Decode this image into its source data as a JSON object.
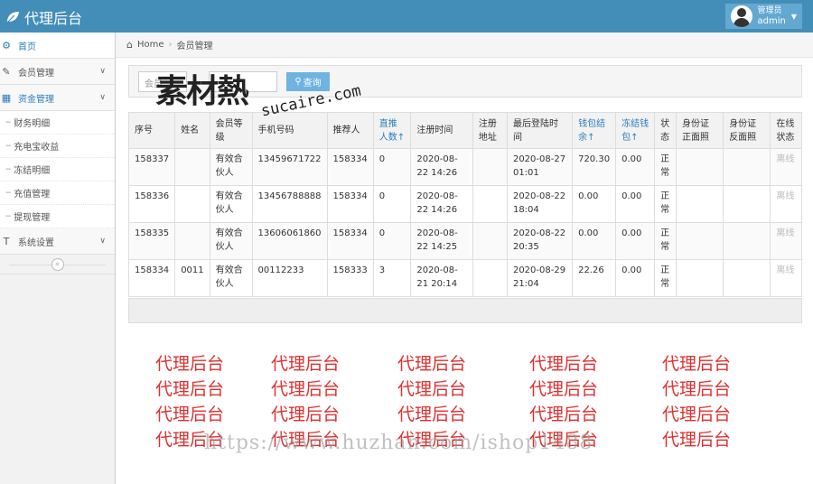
{
  "app": {
    "title": "代理后台"
  },
  "user": {
    "role": "管理员",
    "name": "admin"
  },
  "sidebar": {
    "items": [
      {
        "label": "首页"
      },
      {
        "label": "会员管理"
      },
      {
        "label": "资金管理"
      }
    ],
    "sub_items": [
      {
        "label": "财务明细"
      },
      {
        "label": "充电宝收益"
      },
      {
        "label": "冻结明细"
      },
      {
        "label": "充值管理"
      },
      {
        "label": "提现管理"
      }
    ],
    "settings": {
      "label": "系统设置"
    },
    "collapse_icon": "double-chevron-left-icon"
  },
  "breadcrumb": {
    "home": "Home",
    "current": "会员管理"
  },
  "search": {
    "input_placeholder": "会员",
    "button_label": "查询"
  },
  "table": {
    "headers": [
      "序号",
      "姓名",
      "会员等级",
      "手机号码",
      "推荐人",
      "直推人数↑",
      "注册时间",
      "注册地址",
      "最后登陆时间",
      "钱包结余↑",
      "冻结钱包↑",
      "状态",
      "身份证正面照",
      "身份证反面照",
      "在线状态"
    ],
    "rows": [
      [
        "158337",
        "",
        "有效合伙人",
        "13459671722",
        "158334",
        "0",
        "2020-08-22 14:26",
        "",
        "2020-08-27 01:01",
        "720.30",
        "0.00",
        "正常",
        "",
        "",
        "离线"
      ],
      [
        "158336",
        "",
        "有效合伙人",
        "13456788888",
        "158334",
        "0",
        "2020-08-22 14:26",
        "",
        "2020-08-22 18:04",
        "0.00",
        "0.00",
        "正常",
        "",
        "",
        "离线"
      ],
      [
        "158335",
        "",
        "有效合伙人",
        "13606061860",
        "158334",
        "0",
        "2020-08-22 14:25",
        "",
        "2020-08-22 20:35",
        "0.00",
        "0.00",
        "正常",
        "",
        "",
        "离线"
      ],
      [
        "158334",
        "0011",
        "有效合伙人",
        "00112233",
        "158333",
        "3",
        "2020-08-21 20:14",
        "",
        "2020-08-29 21:04",
        "22.26",
        "0.00",
        "正常",
        "",
        "",
        "离线"
      ]
    ]
  },
  "watermark": {
    "logo_cn": "素材熱",
    "logo_en": "sucaire.com",
    "repeat_text": "代理后台",
    "url": "https://www.huzhan.com/ishop1488"
  },
  "colors": {
    "topbar": "#438eb9",
    "accent": "#2b7dbc",
    "watermark": "#e03030"
  }
}
